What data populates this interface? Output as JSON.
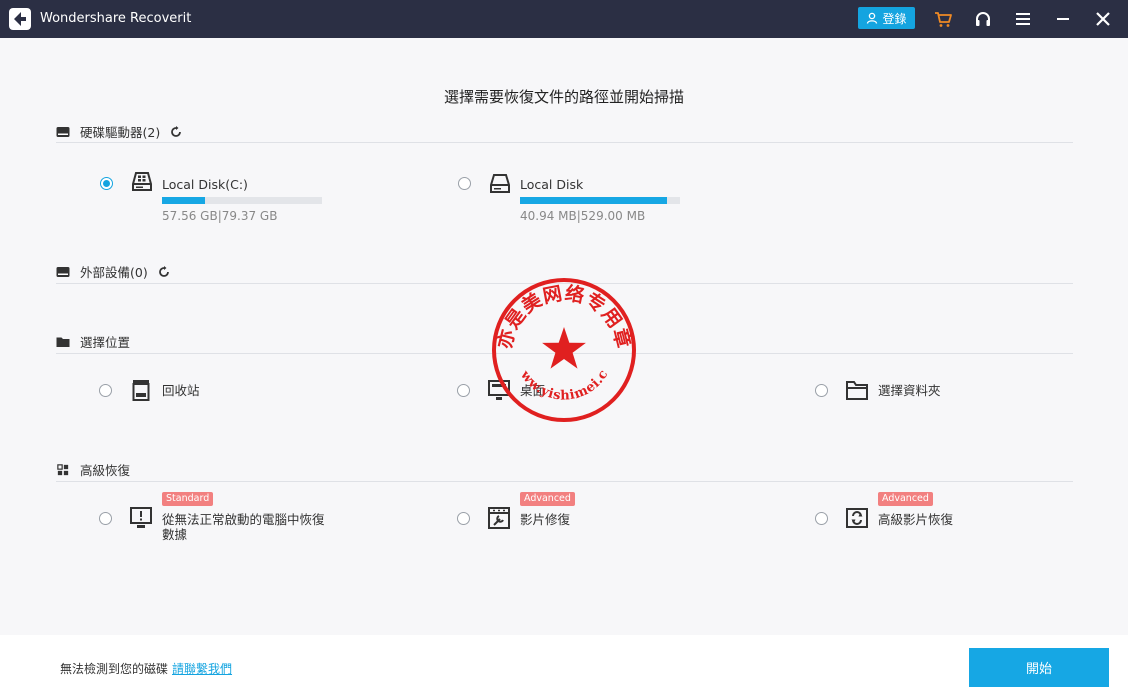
{
  "app": {
    "title": "Wondershare Recoverit",
    "login_label": "登錄"
  },
  "main": {
    "title": "選擇需要恢復文件的路徑並開始掃描"
  },
  "sections": {
    "hard_drives": {
      "header": "硬碟驅動器(2)",
      "disks": [
        {
          "name": "Local Disk(C:)",
          "size": "57.56 GB|79.37 GB",
          "usage": 0.27,
          "selected": true
        },
        {
          "name": "Local Disk",
          "size": "40.94 MB|529.00 MB",
          "usage": 0.92,
          "selected": false
        }
      ]
    },
    "external": {
      "header": "外部設備(0)"
    },
    "location": {
      "header": "選擇位置",
      "items": [
        {
          "label": "回收站",
          "icon": "recycle-bin-icon"
        },
        {
          "label": "桌面",
          "icon": "desktop-icon"
        },
        {
          "label": "選擇資料夾",
          "icon": "folder-icon"
        }
      ]
    },
    "advanced": {
      "header": "高級恢復",
      "items": [
        {
          "badge": "Standard",
          "label_line1": "從無法正常啟動的電腦中恢復",
          "label_line2": "數據",
          "icon": "crashed-computer-icon"
        },
        {
          "badge": "Advanced",
          "label": "影片修復",
          "icon": "video-repair-icon"
        },
        {
          "badge": "Advanced",
          "label": "高級影片恢復",
          "icon": "advanced-video-recovery-icon"
        }
      ]
    }
  },
  "stamp": {
    "top_text": "亦是美网络专用章",
    "bottom_text": "www.yishimei.cn",
    "color": "#e02020"
  },
  "footer": {
    "text": "無法檢測到您的磁碟",
    "link": "請聯繫我們",
    "start_label": "開始"
  },
  "colors": {
    "titlebar": "#2b2f44",
    "accent": "#16a7e4",
    "badge": "#f28080",
    "cart": "#f08a24"
  }
}
